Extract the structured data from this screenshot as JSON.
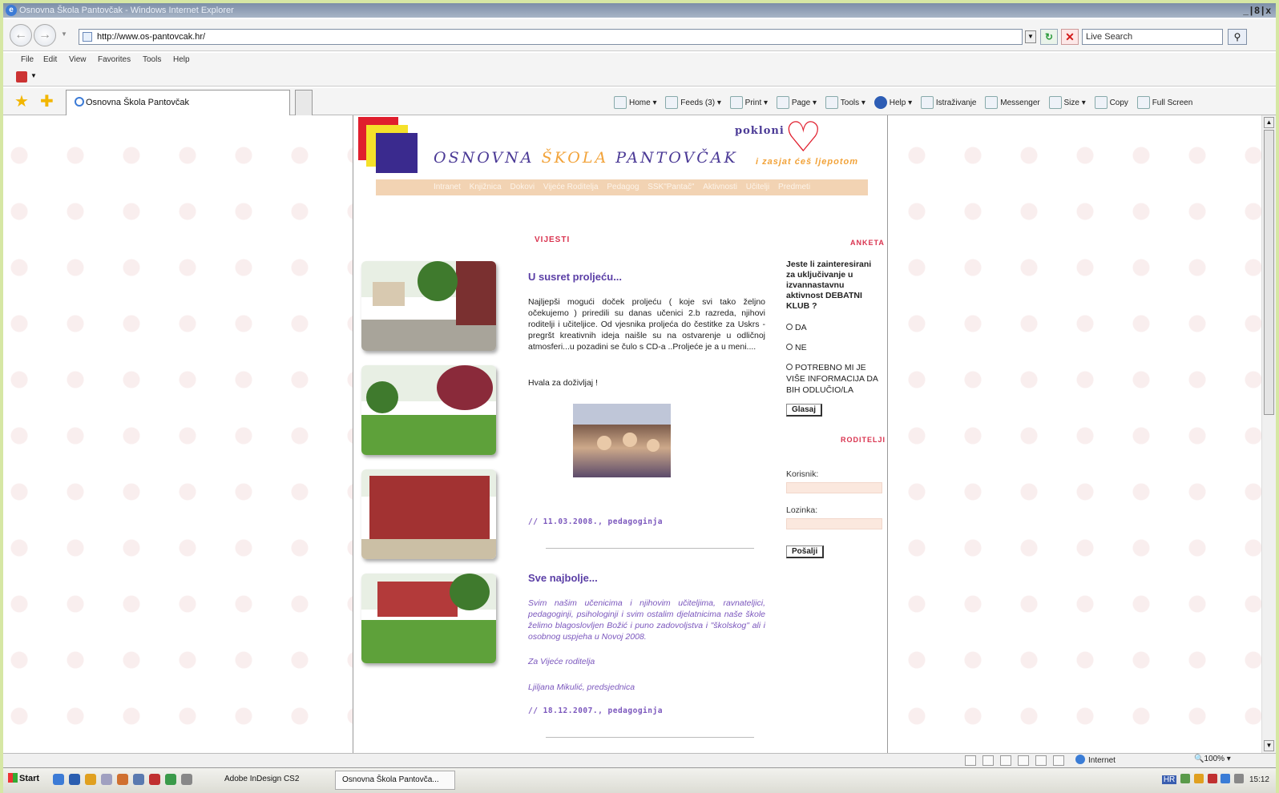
{
  "window": {
    "title": "Osnovna Škola Pantovčak - Windows Internet Explorer",
    "controls": "_|8|x"
  },
  "address": {
    "url": "http://www.os-pantovcak.hr/",
    "search_placeholder": "Live Search"
  },
  "menu": [
    "File",
    "Edit",
    "View",
    "Favorites",
    "Tools",
    "Help"
  ],
  "tab": {
    "label": "Osnovna Škola Pantovčak"
  },
  "commands": [
    "Home",
    "Feeds (3)",
    "Print",
    "Page",
    "Tools",
    "Help",
    "Istraživanje",
    "Messenger",
    "Size",
    "Copy",
    "Full Screen"
  ],
  "header": {
    "name_part1": "OSNOVNA",
    "name_part2": "ŠKOLA",
    "name_part3": "PANTOVČAK",
    "pokloni": "pokloni",
    "tagline": "i zasjat ćeš ljepotom"
  },
  "nav": [
    "Intranet",
    "Knjižnica",
    "Dokovi",
    "Vijeće Roditelja",
    "Pedagog",
    "SSK\"Pantač\"",
    "Aktivnosti",
    "Učitelji",
    "Predmeti"
  ],
  "news": {
    "section_title": "VIJESTI",
    "items": [
      {
        "title": "U susret proljeću...",
        "body": "Najljepši mogući doček proljeću ( koje svi tako željno očekujemo ) priredili su danas učenici 2.b razreda, njihovi roditelji i učiteljice. Od vjesnika proljeća do čestitke za Uskrs - pregršt kreativnih ideja naišle su na ostvarenje u odličnoj atmosferi...u pozadini se čulo s CD-a ..Proljeće je a u meni....",
        "thanks": "Hvala za doživljaj !",
        "date": "// 11.03.2008., pedagoginja"
      },
      {
        "title": "Sve najbolje...",
        "body": "Svim našim učenicima i njihovim učiteljima, ravnateljici, pedagoginji, psihologinji i svim ostalim djelatnicima naše škole želimo blagoslovljen Božić i puno zadovoljstva i \"školskog\" ali i osobnog uspjeha u Novoj 2008.",
        "sign1": "Za Vijeće roditelja",
        "sign2": "Ljiljana Mikulić, predsjednica",
        "date": "// 18.12.2007., pedagoginja"
      }
    ]
  },
  "poll": {
    "section_title": "ANKETA",
    "question": "Jeste li zainteresirani za uključivanje u izvannastavnu aktivnost DEBATNI KLUB ?",
    "options": [
      "DA",
      "NE",
      "POTREBNO MI JE VIŠE INFORMACIJA DA BIH ODLUČIO/LA"
    ],
    "vote_label": "Glasaj"
  },
  "login": {
    "section_title": "RODITELJI",
    "user_label": "Korisnik:",
    "pass_label": "Lozinka:",
    "submit_label": "Pošalji"
  },
  "status": {
    "zone": "Internet",
    "zoom": "100%"
  },
  "taskbar": {
    "start": "Start",
    "items": [
      "Adobe InDesign CS2",
      "Osnovna Škola Pantovča..."
    ],
    "lang": "HR",
    "time": "15:12"
  }
}
